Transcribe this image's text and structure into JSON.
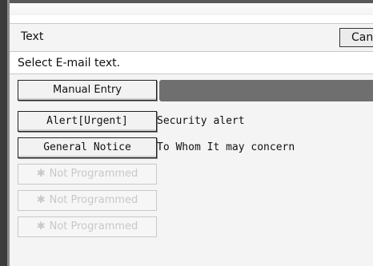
{
  "header": {
    "title": "Text",
    "cancel_label": "Can"
  },
  "instruction": "Select E-mail text.",
  "manual_entry": {
    "label": "Manual Entry"
  },
  "programmed_texts": [
    {
      "label": "Alert[Urgent]",
      "text": "Security alert"
    },
    {
      "label": "General Notice",
      "text": "To Whom It may concern"
    }
  ],
  "unprogrammed": [
    {
      "star": "✱",
      "label": "Not Programmed"
    },
    {
      "star": "✱",
      "label": "Not Programmed"
    },
    {
      "star": "✱",
      "label": "Not Programmed"
    }
  ],
  "colors": {
    "field_fill": "#6f6f6f",
    "disabled_text": "#c8c8c8"
  }
}
